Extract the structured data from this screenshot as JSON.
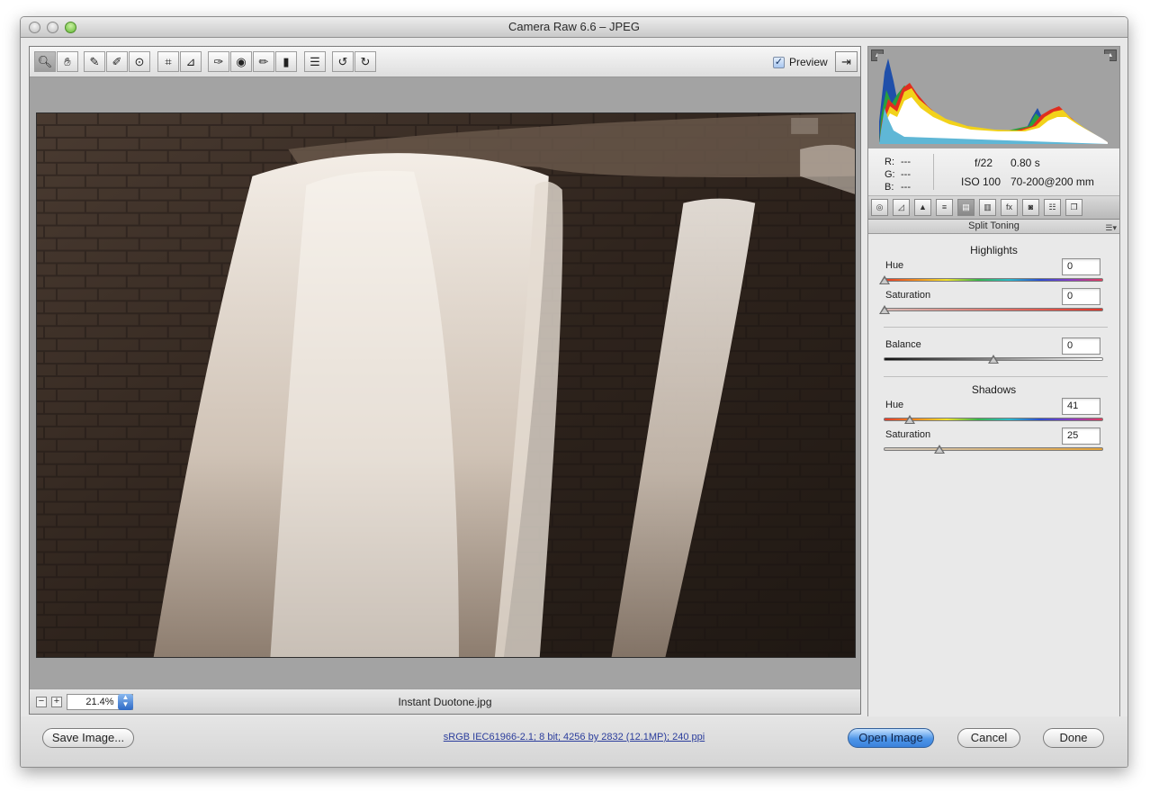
{
  "window": {
    "title": "Camera Raw 6.6  –  JPEG"
  },
  "toolbar": {
    "tools": [
      "zoom-tool",
      "hand-tool",
      "white-balance-tool",
      "color-sampler-tool",
      "targeted-adjustment-tool",
      "crop-tool",
      "straighten-tool",
      "spot-removal-tool",
      "red-eye-removal-tool",
      "adjustment-brush-tool",
      "graduated-filter-tool",
      "open-preferences-tool",
      "rotate-left-tool",
      "rotate-right-tool"
    ],
    "preview_label": "Preview",
    "preview_checked": true
  },
  "status": {
    "zoom": "21.4%",
    "filename": "Instant Duotone.jpg"
  },
  "histogram": {
    "rgb": {
      "r_label": "R:",
      "r": "---",
      "g_label": "G:",
      "g": "---",
      "b_label": "B:",
      "b": "---"
    },
    "aperture": "f/22",
    "shutter": "0.80 s",
    "iso": "ISO 100",
    "lens": "70-200@200 mm"
  },
  "panel": {
    "title": "Split Toning",
    "highlights_heading": "Highlights",
    "highlights_hue_label": "Hue",
    "highlights_hue": "0",
    "highlights_sat_label": "Saturation",
    "highlights_sat": "0",
    "balance_label": "Balance",
    "balance": "0",
    "shadows_heading": "Shadows",
    "shadows_hue_label": "Hue",
    "shadows_hue": "41",
    "shadows_sat_label": "Saturation",
    "shadows_sat": "25"
  },
  "footer": {
    "save_label": "Save Image...",
    "workflow_link": "sRGB IEC61966-2.1; 8 bit; 4256 by 2832 (12.1MP); 240 ppi",
    "open_label": "Open Image",
    "cancel_label": "Cancel",
    "done_label": "Done"
  },
  "colors": {
    "accent": "#3a82dc",
    "photo_tone": "#3b2e25",
    "link": "#2b3d9c"
  }
}
